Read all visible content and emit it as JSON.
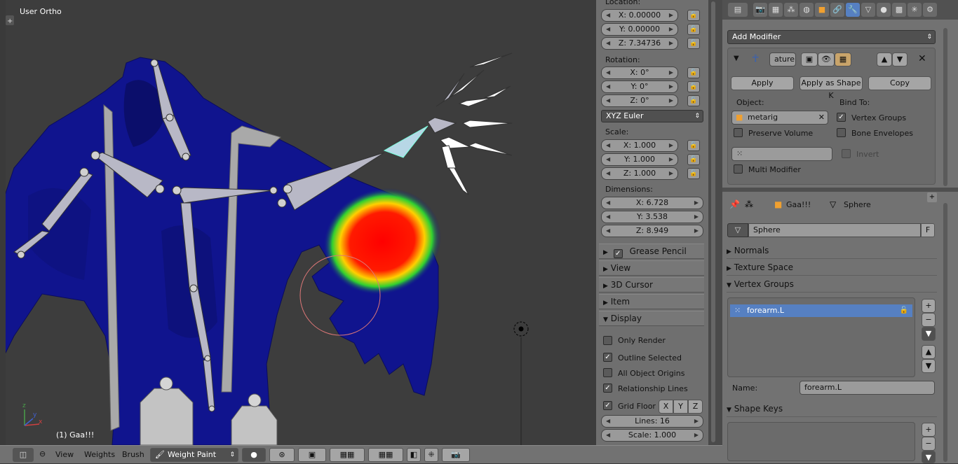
{
  "viewport": {
    "view_name": "User Ortho",
    "object_label": "(1) Gaa!!!",
    "axis_x": "x",
    "axis_y": "y",
    "axis_z": "z"
  },
  "npanel": {
    "location_label": "Location:",
    "location": [
      "X: 0.00000",
      "Y: 0.00000",
      "Z: 7.34736"
    ],
    "rotation_label": "Rotation:",
    "rotation": [
      "X: 0°",
      "Y: 0°",
      "Z: 0°"
    ],
    "rotation_mode": "XYZ Euler",
    "scale_label": "Scale:",
    "scale": [
      "X: 1.000",
      "Y: 1.000",
      "Z: 1.000"
    ],
    "dimensions_label": "Dimensions:",
    "dimensions": [
      "X: 6.728",
      "Y: 3.538",
      "Z: 8.949"
    ],
    "panels": [
      "Grease Pencil",
      "View",
      "3D Cursor",
      "Item",
      "Display"
    ],
    "display_options": [
      {
        "label": "Only Render",
        "checked": false
      },
      {
        "label": "Outline Selected",
        "checked": true
      },
      {
        "label": "All Object Origins",
        "checked": false
      },
      {
        "label": "Relationship Lines",
        "checked": true
      },
      {
        "label": "Grid Floor",
        "checked": true
      }
    ],
    "grid_axes": [
      "X",
      "Y",
      "Z"
    ],
    "lines": "Lines: 16",
    "grid_scale": "Scale: 1.000"
  },
  "modifier": {
    "add_modifier": "Add Modifier",
    "name_field": "ature",
    "apply": "Apply",
    "apply_shape": "Apply as Shape K",
    "copy": "Copy",
    "object_label": "Object:",
    "object_value": "metarig",
    "bind_to_label": "Bind To:",
    "vertex_groups": "Vertex Groups",
    "bone_envelopes": "Bone Envelopes",
    "preserve_volume": "Preserve Volume",
    "invert": "Invert",
    "multi_modifier": "Multi Modifier"
  },
  "data_props": {
    "breadcrumb_object": "Gaa!!!",
    "breadcrumb_mesh": "Sphere",
    "mesh_name": "Sphere",
    "fake_user": "F",
    "sections": [
      "Normals",
      "Texture Space",
      "Vertex Groups"
    ],
    "vertex_group_item": "forearm.L",
    "name_label": "Name:",
    "name_value": "forearm.L",
    "shape_keys": "Shape Keys"
  },
  "header": {
    "view": "View",
    "weights": "Weights",
    "brush": "Brush",
    "mode": "Weight Paint"
  },
  "colors": {
    "mesh_blue": "#10148e",
    "weight_red": "#ff0000",
    "selected_item": "#5680c2",
    "viewport_bg": "#3d3d3d"
  }
}
